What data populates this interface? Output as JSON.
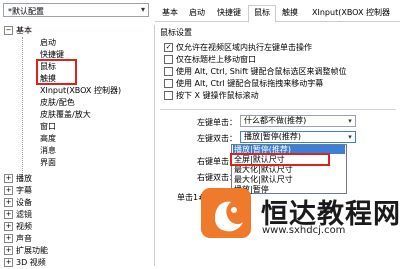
{
  "profile": {
    "value": "*默认配置"
  },
  "tree": {
    "items": [
      {
        "label": "基本",
        "expander": "−"
      },
      {
        "label": "启动"
      },
      {
        "label": "快捷键"
      },
      {
        "label": "鼠标"
      },
      {
        "label": "触摸"
      },
      {
        "label": "XInput(XBOX 控制器)"
      },
      {
        "label": "皮肤/配色"
      },
      {
        "label": "皮肤覆盖/放大"
      },
      {
        "label": "窗口"
      },
      {
        "label": "高度"
      },
      {
        "label": "消息"
      },
      {
        "label": "界面"
      },
      {
        "label": "播放",
        "expander": "+"
      },
      {
        "label": "字幕",
        "expander": "+"
      },
      {
        "label": "设备",
        "expander": "+"
      },
      {
        "label": "滤镜",
        "expander": "+"
      },
      {
        "label": "视频",
        "expander": "+"
      },
      {
        "label": "声音",
        "expander": "+"
      },
      {
        "label": "扩展功能",
        "expander": "+"
      },
      {
        "label": "3D 视频",
        "expander": "+"
      }
    ]
  },
  "tabs": [
    "基本",
    "启动",
    "快捷键",
    "鼠标",
    "触摸",
    "XInput(XBOX 控制器"
  ],
  "mouse": {
    "group_title": "鼠标设置",
    "options": [
      {
        "label": "仅允许在视频区域内执行左键单击操作",
        "checked": true
      },
      {
        "label": "仅在标题栏上移动窗口",
        "checked": false
      },
      {
        "label": "使用 Alt, Ctrl, Shift 键配合鼠标选区来调整帧位",
        "checked": false
      },
      {
        "label": "使用 Alt, Ctrl 键配合鼠标拖拽来移动字幕",
        "checked": false
      },
      {
        "label": "按下 X 键操作鼠标滚动",
        "checked": false
      }
    ],
    "left_click_label": "左键单击：",
    "left_click_value": "什么都不做(推荐)",
    "left_dbl_label": "左键双击：",
    "left_dbl_value": "播放|暂停(推荐)",
    "right_click_label": "右键单击：",
    "right_dbl_label": "右键双击：",
    "click_x_label": "单击1# X 键："
  },
  "dropdown": {
    "items": [
      "播放|暂停(推荐)",
      "全屏|默认尺寸",
      "最大化|默认尺寸",
      "最大化|默认尺寸",
      "播放|暂停"
    ],
    "selected_index": 0
  },
  "watermark": {
    "text": "恒达教程网",
    "url": "www.sxhdcj.com"
  }
}
